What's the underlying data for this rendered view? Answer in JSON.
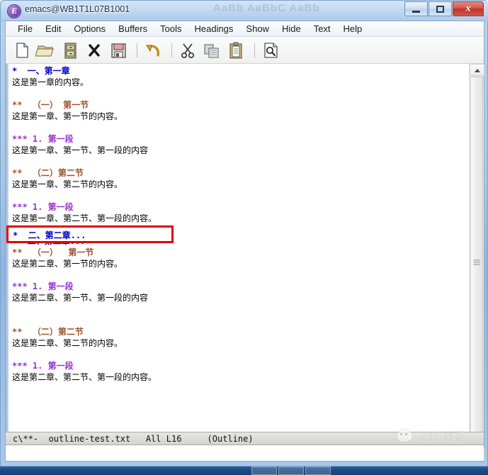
{
  "window": {
    "title": "emacs@WB1T1L07B1001",
    "app_icon": "emacs-icon",
    "ghost_text": "AaBb AaBbC AaBb",
    "controls": {
      "minimize": "minimize-button",
      "maximize": "maximize-button",
      "close_label": "x"
    }
  },
  "menubar": {
    "items": [
      {
        "label": "File"
      },
      {
        "label": "Edit"
      },
      {
        "label": "Options"
      },
      {
        "label": "Buffers"
      },
      {
        "label": "Tools"
      },
      {
        "label": "Headings"
      },
      {
        "label": "Show"
      },
      {
        "label": "Hide"
      },
      {
        "label": "Text"
      },
      {
        "label": "Help"
      }
    ]
  },
  "toolbar": {
    "buttons": [
      {
        "name": "new-file-icon",
        "tip": "New File"
      },
      {
        "name": "open-folder-icon",
        "tip": "Open File"
      },
      {
        "name": "dired-cabinet-icon",
        "tip": "Open Directory"
      },
      {
        "name": "close-x-icon",
        "tip": "Close Buffer"
      },
      {
        "name": "save-floppy-icon",
        "tip": "Save"
      },
      {
        "name": "undo-arrow-icon",
        "tip": "Undo"
      },
      {
        "name": "cut-scissors-icon",
        "tip": "Cut"
      },
      {
        "name": "copy-icon",
        "tip": "Copy"
      },
      {
        "name": "paste-clipboard-icon",
        "tip": "Paste"
      },
      {
        "name": "search-magnifier-icon",
        "tip": "Search"
      }
    ]
  },
  "buffer": {
    "lines": [
      {
        "type": "h1",
        "stars": "*",
        "text": "  一、第一章"
      },
      {
        "type": "body",
        "stars": "",
        "text": "这是第一章的内容。"
      },
      {
        "type": "blank",
        "stars": "",
        "text": ""
      },
      {
        "type": "h2",
        "stars": "**",
        "text": "  （一） 第一节"
      },
      {
        "type": "body",
        "stars": "",
        "text": "这是第一章、第一节的内容。"
      },
      {
        "type": "blank",
        "stars": "",
        "text": ""
      },
      {
        "type": "h3",
        "stars": "***",
        "text": " 1. 第一段"
      },
      {
        "type": "body",
        "stars": "",
        "text": "这是第一章、第一节、第一段的内容"
      },
      {
        "type": "blank",
        "stars": "",
        "text": ""
      },
      {
        "type": "h2",
        "stars": "**",
        "text": "  （二）第二节"
      },
      {
        "type": "body",
        "stars": "",
        "text": "这是第一章、第二节的内容。"
      },
      {
        "type": "blank",
        "stars": "",
        "text": ""
      },
      {
        "type": "h3",
        "stars": "***",
        "text": " 1. 第一段"
      },
      {
        "type": "body",
        "stars": "",
        "text": "这是第一章、第二节、第一段的内容。"
      },
      {
        "type": "blank",
        "stars": "",
        "text": ""
      },
      {
        "type": "h1",
        "stars": "*",
        "text": "  二、第二章..."
      },
      {
        "type": "h2",
        "stars": "**",
        "text": "  （一）  第一节"
      },
      {
        "type": "body",
        "stars": "",
        "text": "这是第二章、第一节的内容。"
      },
      {
        "type": "blank",
        "stars": "",
        "text": ""
      },
      {
        "type": "h3",
        "stars": "***",
        "text": " 1. 第一段"
      },
      {
        "type": "body",
        "stars": "",
        "text": "这是第二章、第一节、第一段的内容"
      },
      {
        "type": "blank",
        "stars": "",
        "text": ""
      },
      {
        "type": "blank",
        "stars": "",
        "text": ""
      },
      {
        "type": "h2",
        "stars": "**",
        "text": "  （二）第二节"
      },
      {
        "type": "body",
        "stars": "",
        "text": "这是第二章、第二节的内容。"
      },
      {
        "type": "blank",
        "stars": "",
        "text": ""
      },
      {
        "type": "h3",
        "stars": "***",
        "text": " 1. 第一段"
      },
      {
        "type": "body",
        "stars": "",
        "text": "这是第二章、第二节、第一段的内容。"
      }
    ],
    "highlight": {
      "line_index": 15,
      "stars": "*",
      "text": "  二、第二章...",
      "border_color": "#e60000"
    },
    "colors": {
      "level1": "#0000cd",
      "level2": "#a0522d",
      "level3": "#9932cc",
      "body": "#000000"
    }
  },
  "modeline": {
    "text": "c\\**-  outline-test.txt   All L16     (Outline)"
  },
  "scrollbar": {
    "up_arrow": "scroll-up-arrow",
    "down_arrow": "scroll-down-arrow",
    "thumb": "scroll-thumb"
  },
  "watermark": {
    "icon": "wechat-icon",
    "text": "艾特 数据"
  }
}
